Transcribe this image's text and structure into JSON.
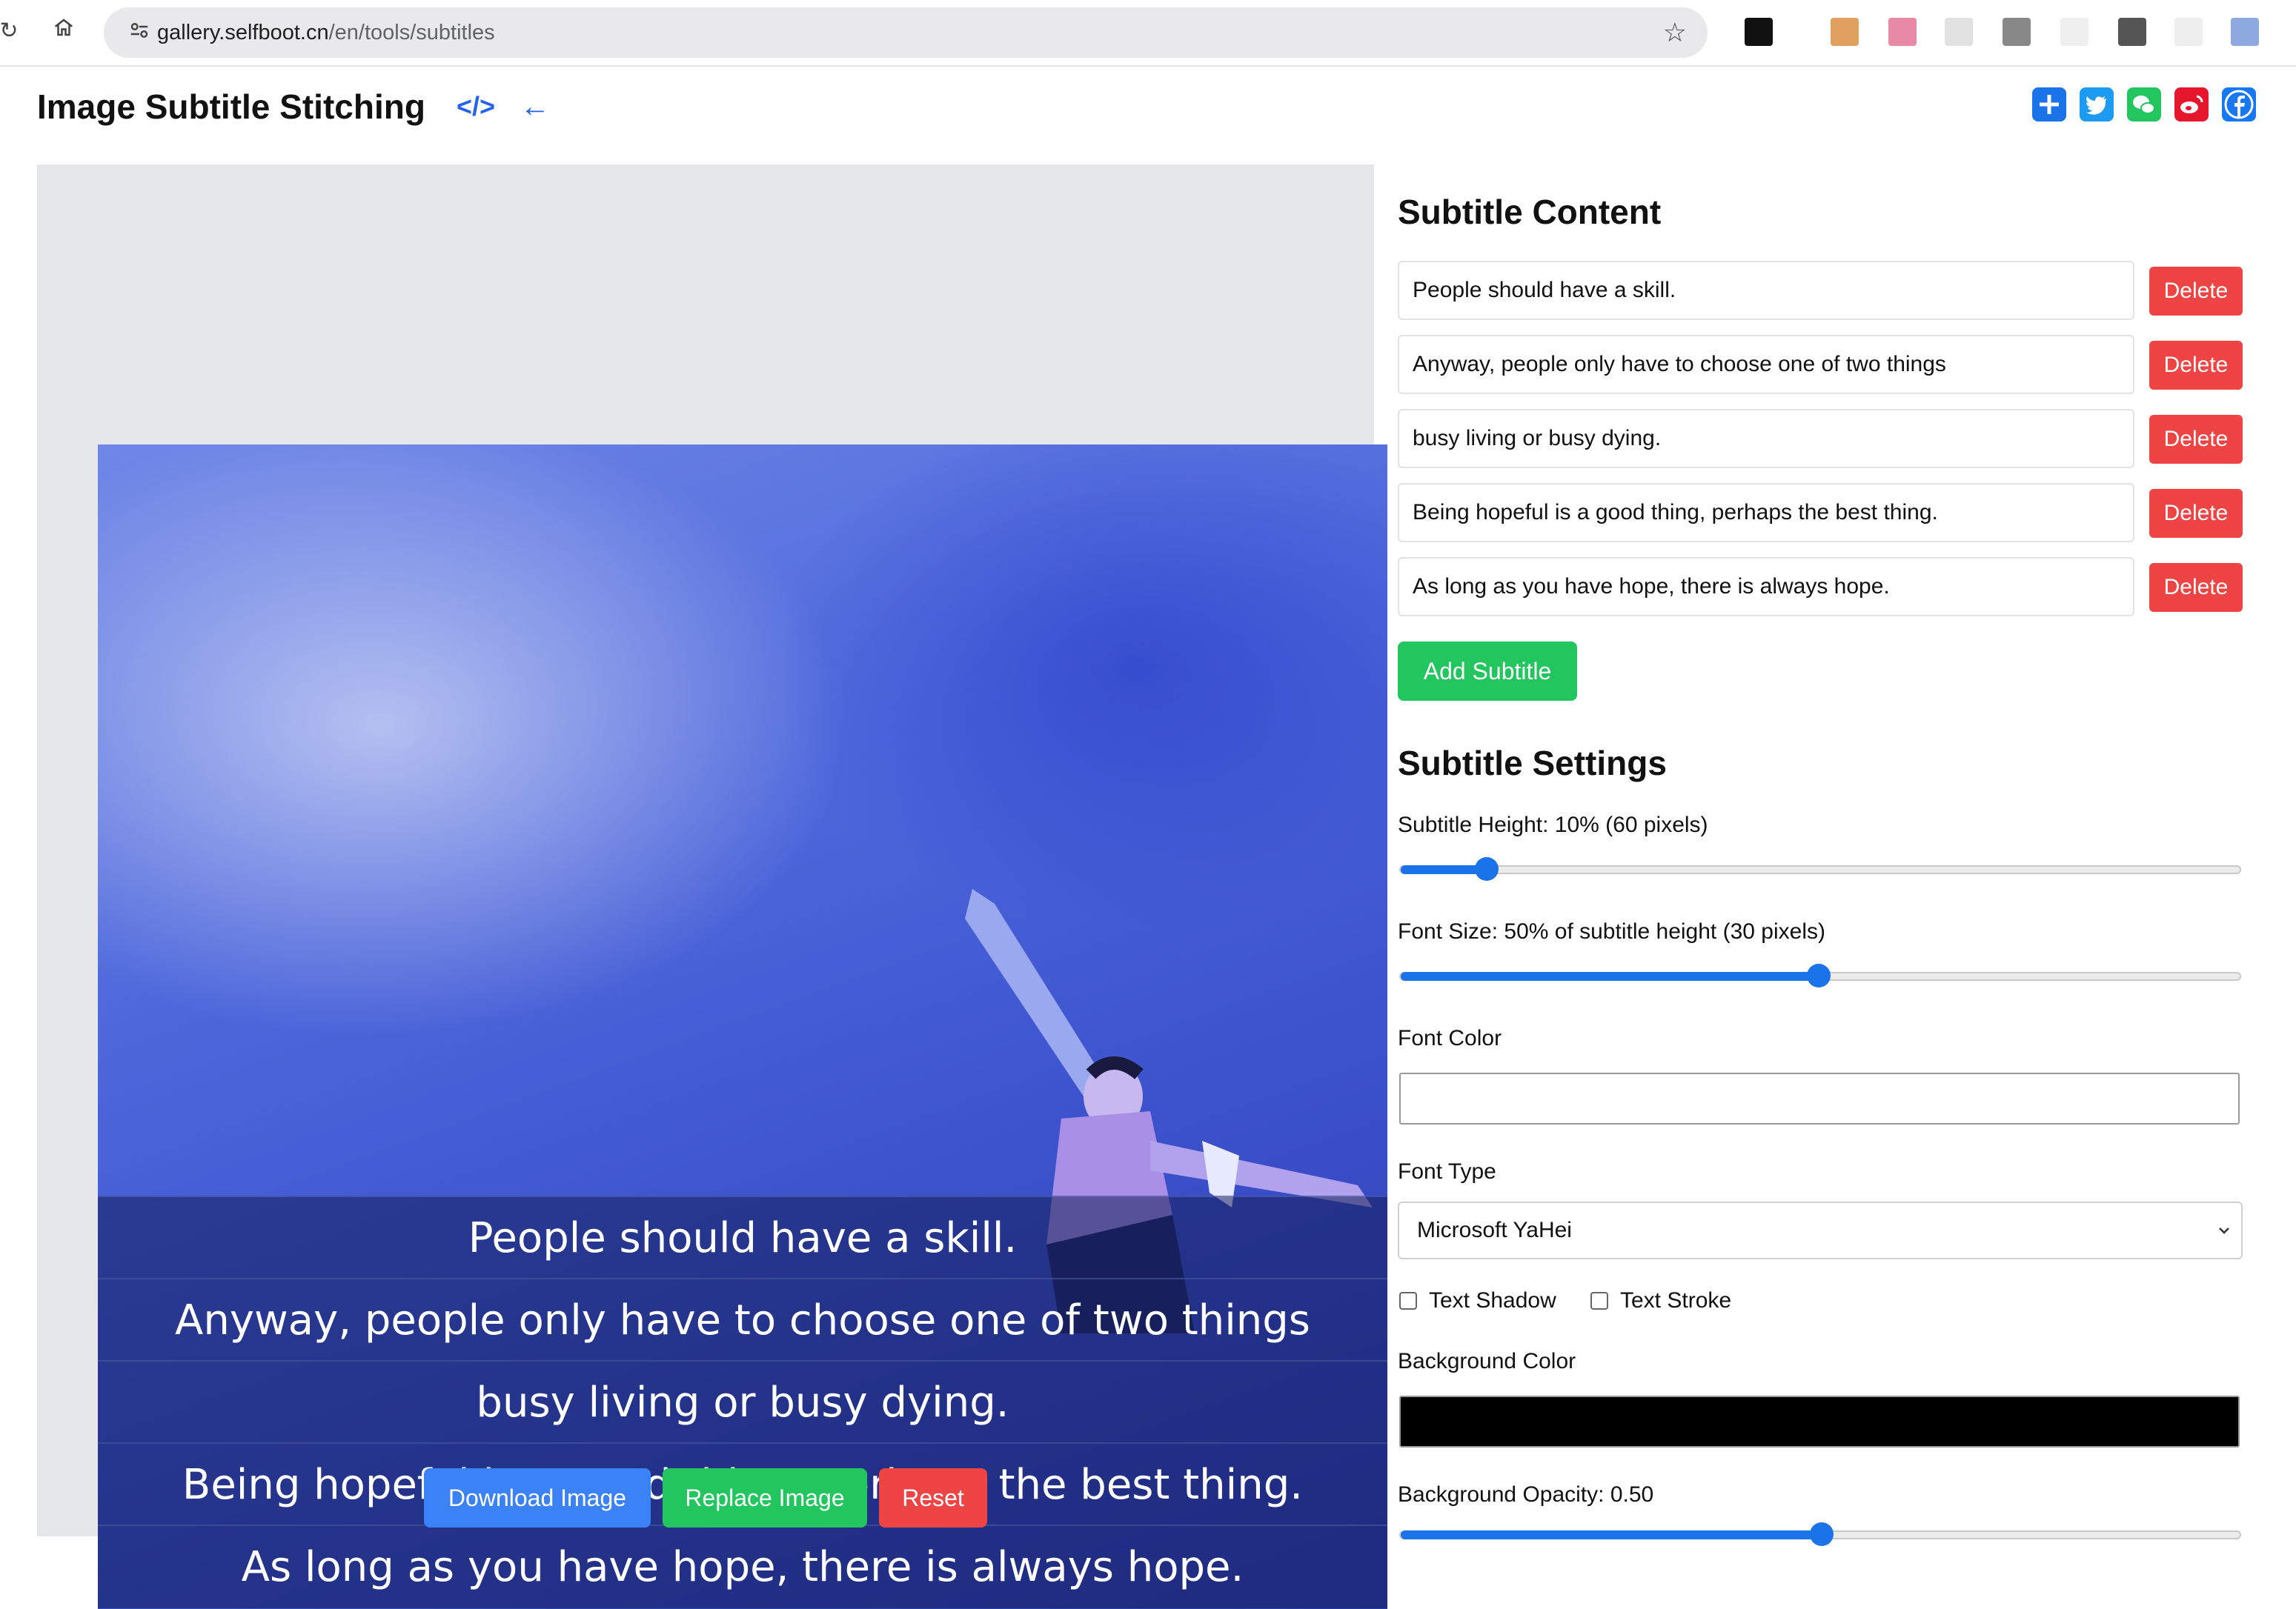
{
  "browser": {
    "url_host": "gallery.selfboot.cn",
    "url_path": "/en/tools/subtitles"
  },
  "header": {
    "title": "Image Subtitle Stitching"
  },
  "subtitles": [
    "People should have a skill.",
    "Anyway, people only have to choose one of two things",
    "busy living or busy dying.",
    "Being hopeful is a good thing, perhaps the best thing.",
    "As long as you have hope, there is always hope."
  ],
  "preview": {
    "download_label": "Download Image",
    "replace_label": "Replace Image",
    "reset_label": "Reset"
  },
  "content_section": {
    "title": "Subtitle Content",
    "delete_label": "Delete",
    "add_label": "Add Subtitle"
  },
  "settings": {
    "title": "Subtitle Settings",
    "height_label": "Subtitle Height: 10% (60 pixels)",
    "height_value": 0.1,
    "font_size_label": "Font Size: 50% of subtitle height (30 pixels)",
    "font_size_value": 0.5,
    "font_color_label": "Font Color",
    "font_color": "#ffffff",
    "font_type_label": "Font Type",
    "font_type_selected": "Microsoft YaHei",
    "text_shadow_label": "Text Shadow",
    "text_shadow_checked": false,
    "text_stroke_label": "Text Stroke",
    "text_stroke_checked": false,
    "bg_color_label": "Background Color",
    "bg_color": "#000000",
    "bg_opacity_label": "Background Opacity: 0.50",
    "bg_opacity_value": 0.5
  },
  "colors": {
    "accent_blue": "#3b82f6",
    "green": "#22c55e",
    "red": "#ef4444"
  }
}
